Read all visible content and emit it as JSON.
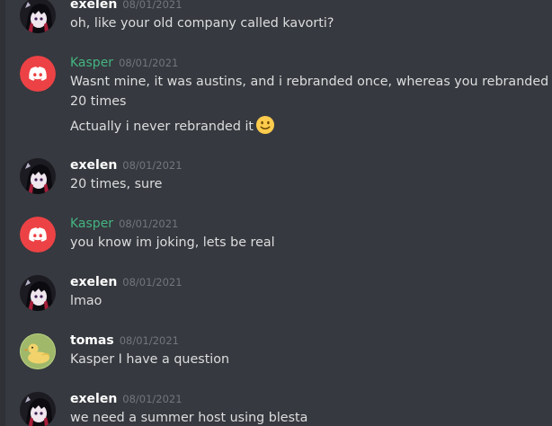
{
  "messages": [
    {
      "author": "exelen",
      "author_color": "#ffffff",
      "timestamp": "08/01/2021",
      "avatar": "exelen-avatar",
      "lines": [
        "oh, like your old company called kavorti?"
      ]
    },
    {
      "author": "Kasper",
      "author_color": "#43b581",
      "timestamp": "08/01/2021",
      "avatar": "discord-logo-avatar",
      "lines": [
        "Wasnt mine, it was austins, and i rebranded once, whereas you rebranded",
        "20 times",
        "Actually i never rebranded it"
      ],
      "emoji": "slightly-smiling-face-emoji"
    },
    {
      "author": "exelen",
      "author_color": "#ffffff",
      "timestamp": "08/01/2021",
      "avatar": "exelen-avatar",
      "lines": [
        "20 times, sure"
      ]
    },
    {
      "author": "Kasper",
      "author_color": "#43b581",
      "timestamp": "08/01/2021",
      "avatar": "discord-logo-avatar",
      "lines": [
        "you know im joking, lets be real"
      ]
    },
    {
      "author": "exelen",
      "author_color": "#ffffff",
      "timestamp": "08/01/2021",
      "avatar": "exelen-avatar",
      "lines": [
        "lmao"
      ]
    },
    {
      "author": "tomas",
      "author_color": "#ffffff",
      "timestamp": "08/01/2021",
      "avatar": "duck-avatar",
      "lines": [
        "Kasper I have a question"
      ]
    },
    {
      "author": "exelen",
      "author_color": "#ffffff",
      "timestamp": "08/01/2021",
      "avatar": "exelen-avatar",
      "lines": [
        "we need a summer host using blesta"
      ]
    }
  ],
  "colors": {
    "background": "#36393f",
    "text": "#dcddde",
    "timestamp": "#72767d",
    "discord_red": "#ed4245",
    "kasper_green": "#43b581"
  }
}
